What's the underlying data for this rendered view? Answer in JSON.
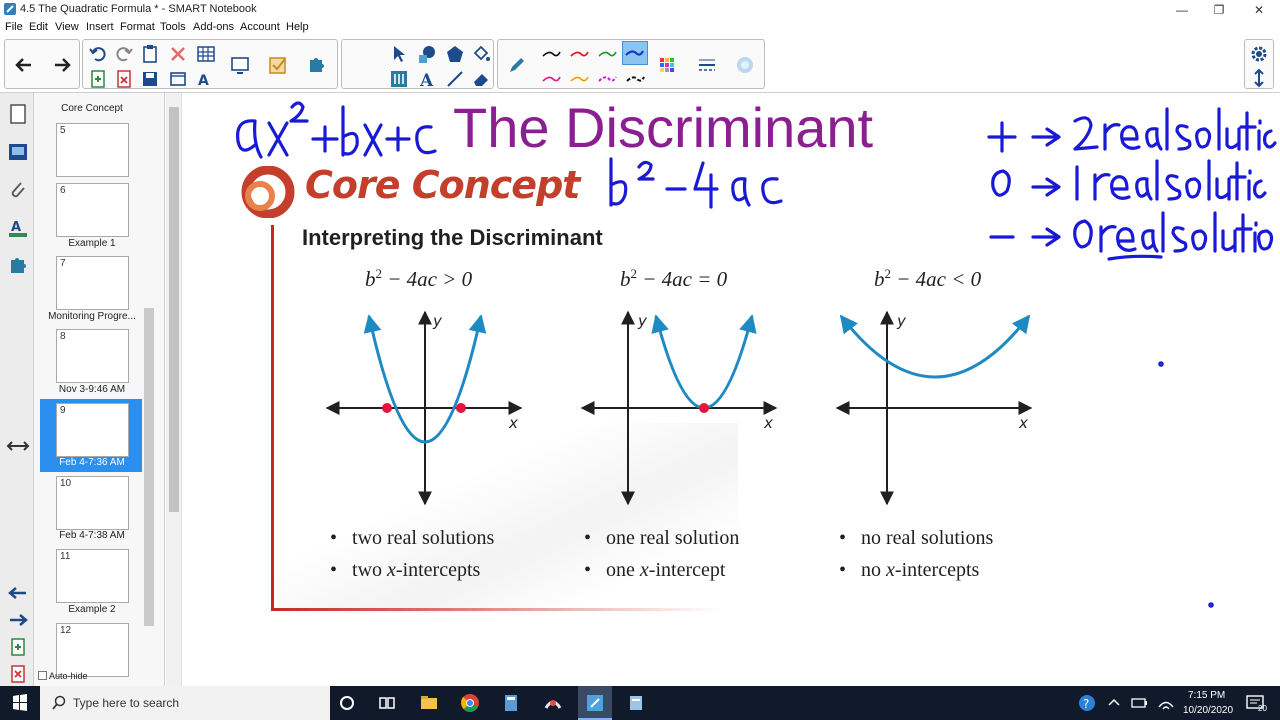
{
  "window": {
    "title": "4.5 The Quadratic Formula * - SMART Notebook",
    "controls": [
      "minimize",
      "maximize",
      "close"
    ]
  },
  "menu": [
    "File",
    "Edit",
    "View",
    "Insert",
    "Format",
    "Tools",
    "Add-ons",
    "Account",
    "Help"
  ],
  "sidebar": {
    "thumbnails": [
      {
        "num": "5",
        "label": "Core Concept"
      },
      {
        "num": "6",
        "label": "Example 1"
      },
      {
        "num": "7",
        "label": "Monitoring Progre..."
      },
      {
        "num": "8",
        "label": "Nov 3-9:46 AM"
      },
      {
        "num": "9",
        "label": "Feb 4-7:36 AM"
      },
      {
        "num": "10",
        "label": "Feb 4-7:38 AM"
      },
      {
        "num": "11",
        "label": "Example 2"
      },
      {
        "num": "12",
        "label": ""
      }
    ],
    "selected_label": "Feb 4-7:36 AM",
    "top_label": "Core Concept",
    "autohide": "Auto-hide"
  },
  "page": {
    "title": "The Discriminant",
    "core_concept": "Core Concept",
    "heading": "Interpreting the Discriminant",
    "cases": [
      {
        "label_pre": "b",
        "label_sup": "2",
        "label_post": " − 4ac > 0",
        "bullet1": "two real solutions",
        "bullet2_pre": "two ",
        "bullet2_it": "x",
        "bullet2_post": "-intercepts"
      },
      {
        "label_pre": "b",
        "label_sup": "2",
        "label_post": " − 4ac = 0",
        "bullet1": "one real solution",
        "bullet2_pre": "one ",
        "bullet2_it": "x",
        "bullet2_post": "-intercept"
      },
      {
        "label_pre": "b",
        "label_sup": "2",
        "label_post": " − 4ac < 0",
        "bullet1": "no real solutions",
        "bullet2_pre": "no ",
        "bullet2_it": "x",
        "bullet2_post": "-intercepts"
      }
    ],
    "axis_x": "x",
    "axis_y": "y",
    "colors": {
      "title": "#8b1e91",
      "ink": "#1a1ad6",
      "curve": "#1d8ac4",
      "point": "#e8143c",
      "frame": "#c5281f"
    }
  },
  "taskbar": {
    "search_placeholder": "Type here to search",
    "time": "7:15 PM",
    "date": "10/20/2020",
    "notifications": "20"
  }
}
